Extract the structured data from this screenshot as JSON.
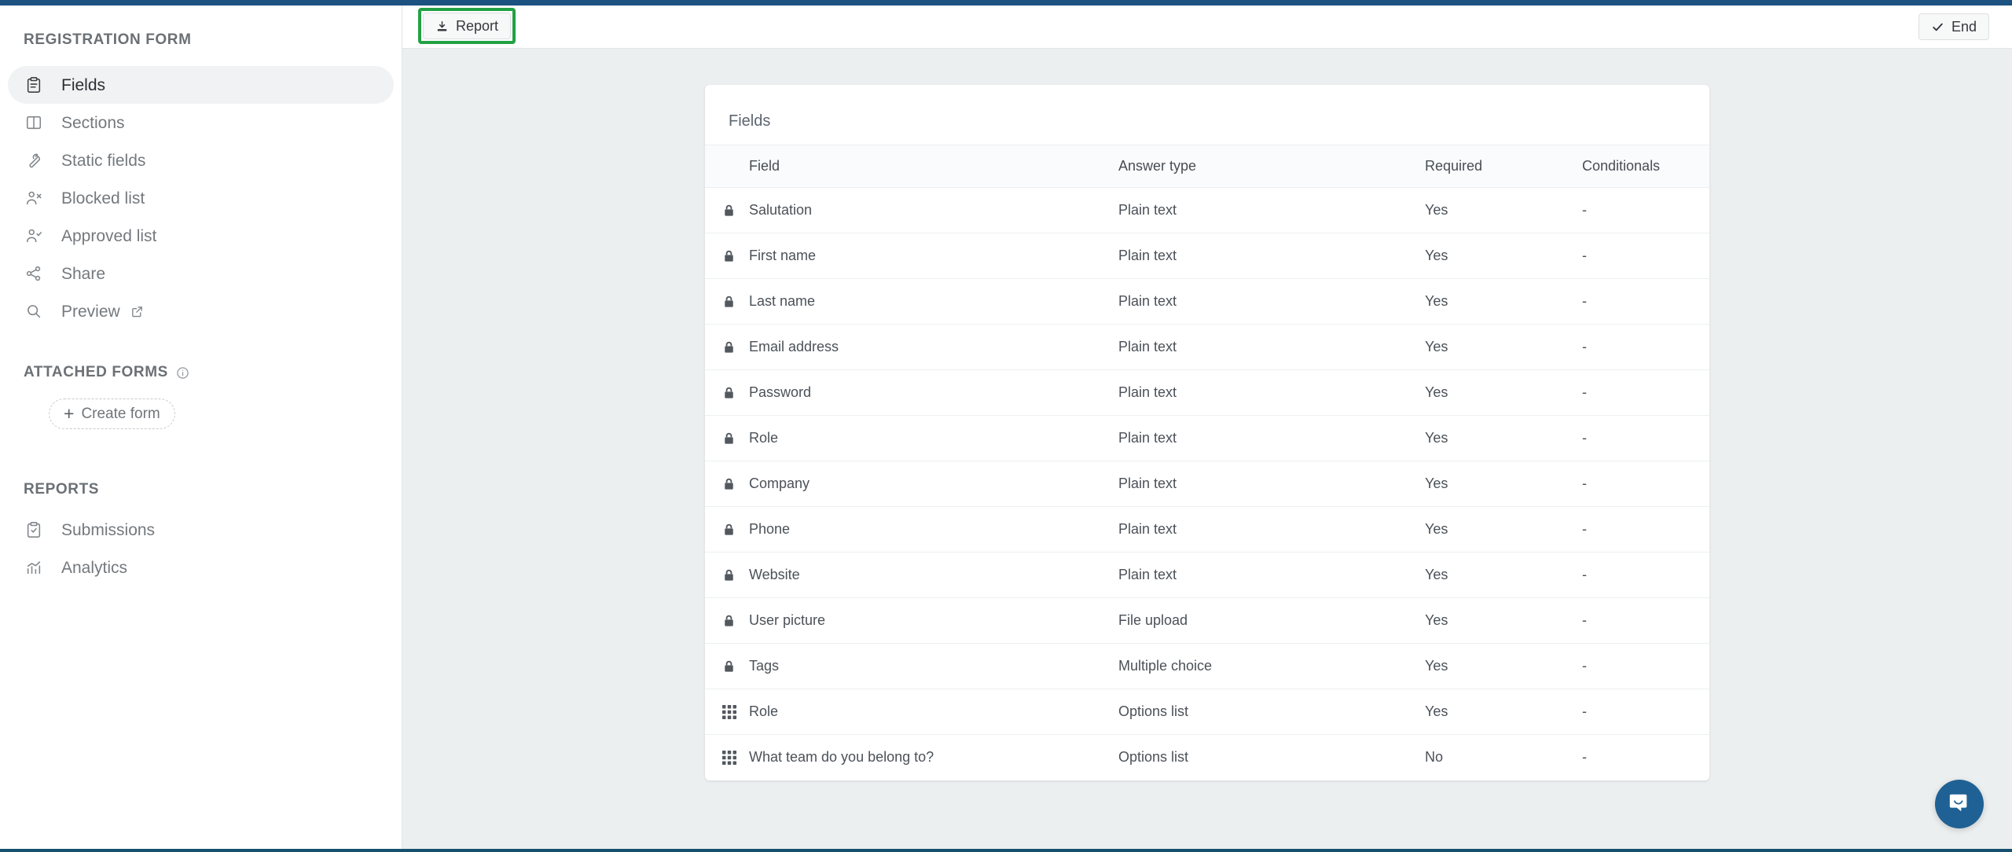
{
  "theme": {
    "accent_bar": "#1b5280",
    "highlight_green": "#22a144",
    "chat_blue": "#1f6194",
    "main_bg": "#eceff0"
  },
  "sidebar": {
    "title": "REGISTRATION FORM",
    "nav_items": [
      {
        "label": "Fields",
        "icon": "clipboard-icon",
        "active": true
      },
      {
        "label": "Sections",
        "icon": "columns-icon",
        "active": false
      },
      {
        "label": "Static fields",
        "icon": "wrench-icon",
        "active": false
      },
      {
        "label": "Blocked list",
        "icon": "user-x-icon",
        "active": false
      },
      {
        "label": "Approved list",
        "icon": "user-check-icon",
        "active": false
      },
      {
        "label": "Share",
        "icon": "share-icon",
        "active": false
      },
      {
        "label": "Preview",
        "icon": "search-icon",
        "active": false,
        "external": true
      }
    ],
    "attached_forms": {
      "heading": "ATTACHED FORMS",
      "info_icon": "info-icon",
      "create_button": "Create form",
      "plus": "+"
    },
    "reports": {
      "heading": "REPORTS",
      "items": [
        {
          "label": "Submissions",
          "icon": "clipboard-check-icon"
        },
        {
          "label": "Analytics",
          "icon": "bar-chart-icon"
        }
      ]
    }
  },
  "header": {
    "report_button": {
      "label": "Report",
      "icon": "download-icon",
      "highlighted": true
    },
    "end_button": {
      "label": "End",
      "icon": "check-icon"
    }
  },
  "main": {
    "card_title": "Fields",
    "table": {
      "columns": [
        "",
        "Field",
        "Answer type",
        "Required",
        "Conditionals"
      ],
      "rows": [
        {
          "icon": "lock-icon",
          "field": "Salutation",
          "answer_type": "Plain text",
          "required": "Yes",
          "conditionals": "-"
        },
        {
          "icon": "lock-icon",
          "field": "First name",
          "answer_type": "Plain text",
          "required": "Yes",
          "conditionals": "-"
        },
        {
          "icon": "lock-icon",
          "field": "Last name",
          "answer_type": "Plain text",
          "required": "Yes",
          "conditionals": "-"
        },
        {
          "icon": "lock-icon",
          "field": "Email address",
          "answer_type": "Plain text",
          "required": "Yes",
          "conditionals": "-"
        },
        {
          "icon": "lock-icon",
          "field": "Password",
          "answer_type": "Plain text",
          "required": "Yes",
          "conditionals": "-"
        },
        {
          "icon": "lock-icon",
          "field": "Role",
          "answer_type": "Plain text",
          "required": "Yes",
          "conditionals": "-"
        },
        {
          "icon": "lock-icon",
          "field": "Company",
          "answer_type": "Plain text",
          "required": "Yes",
          "conditionals": "-"
        },
        {
          "icon": "lock-icon",
          "field": "Phone",
          "answer_type": "Plain text",
          "required": "Yes",
          "conditionals": "-"
        },
        {
          "icon": "lock-icon",
          "field": "Website",
          "answer_type": "Plain text",
          "required": "Yes",
          "conditionals": "-"
        },
        {
          "icon": "lock-icon",
          "field": "User picture",
          "answer_type": "File upload",
          "required": "Yes",
          "conditionals": "-"
        },
        {
          "icon": "lock-icon",
          "field": "Tags",
          "answer_type": "Multiple choice",
          "required": "Yes",
          "conditionals": "-"
        },
        {
          "icon": "grid-icon",
          "field": "Role",
          "answer_type": "Options list",
          "required": "Yes",
          "conditionals": "-"
        },
        {
          "icon": "grid-icon",
          "field": "What team do you belong to?",
          "answer_type": "Options list",
          "required": "No",
          "conditionals": "-"
        }
      ]
    }
  },
  "chat": {
    "icon": "chat-smile-icon"
  }
}
